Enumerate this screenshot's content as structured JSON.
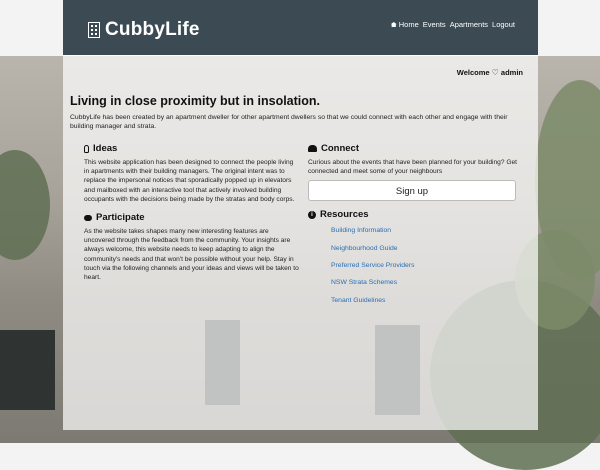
{
  "navbar": {
    "brand": "CubbyLife",
    "links": [
      "Home",
      "Events",
      "Apartments",
      "Logout"
    ]
  },
  "welcome": {
    "prefix": "Welcome",
    "user": "admin"
  },
  "main": {
    "title": "Living in close proximity but in insolation.",
    "intro": "CubbyLife has been created by an apartment dweller for other apartment dwellers so that we could connect with each other and engage with their building manager and strata.",
    "ideas": {
      "heading": "Ideas",
      "text": "This website application has been designed to connect the people living in apartments with their building managers. The original intent was to replace the impersonal notices that sporadically popped up in elevators and mailboxed with an interactive tool that actively involved building occupants with the decisions being made by the stratas and body corps."
    },
    "participate": {
      "heading": "Participate",
      "text": "As the website takes shapes many new interesting features are uncovered through the feedback from the community. Your insights are always welcome, this website needs to keep adapting to align the community's needs and that won't be possible without your help. Stay in touch via the following channels and your ideas and views will be taken to heart."
    },
    "connect": {
      "heading": "Connect",
      "text": "Curious about the events that have been planned for your building? Get connected and meet some of your neighbours",
      "button": "Sign up"
    },
    "resources": {
      "heading": "Resources",
      "items": [
        "Building Information",
        "Neighbourhood Guide",
        "Preferred Service Providers",
        "NSW Strata Schemes",
        "Tenant Guidelines"
      ]
    }
  },
  "icons": {
    "brand": "building-icon",
    "home": "home-icon",
    "welcome": "heart-icon",
    "ideas": "lightbulb-icon",
    "participate": "comments-icon",
    "connect": "users-icon",
    "resources": "info-circle-icon"
  },
  "colors": {
    "navbar": "#3b4a53",
    "link": "#2a6db5"
  }
}
